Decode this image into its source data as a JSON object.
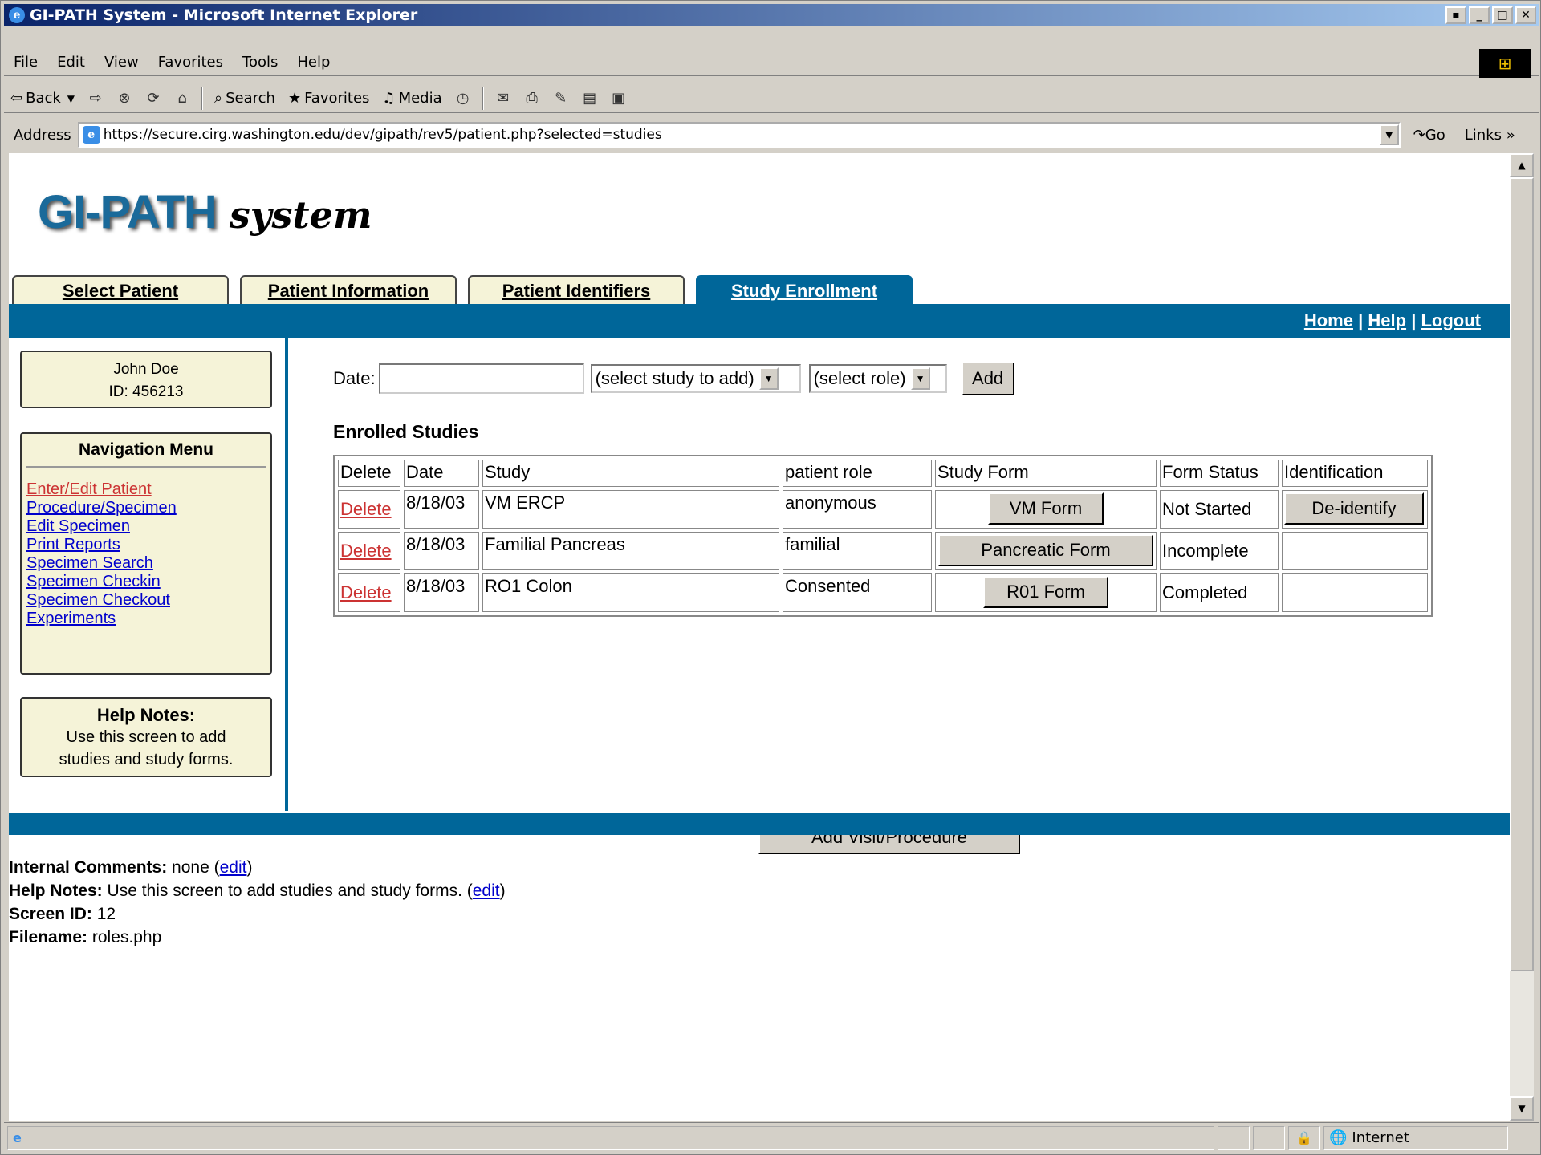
{
  "window": {
    "title": "GI-PATH System - Microsoft Internet Explorer"
  },
  "menu": [
    "File",
    "Edit",
    "View",
    "Favorites",
    "Tools",
    "Help"
  ],
  "toolbar": {
    "back": "Back",
    "search": "Search",
    "favorites": "Favorites",
    "media": "Media"
  },
  "address": {
    "label": "Address",
    "url": "https://secure.cirg.washington.edu/dev/gipath/rev5/patient.php?selected=studies",
    "go": "Go",
    "links": "Links"
  },
  "logo": {
    "main": "GI-PATH",
    "sub": "system"
  },
  "tabs": [
    "Select Patient",
    "Patient Information",
    "Patient Identifiers",
    "Study Enrollment"
  ],
  "active_tab": "Study Enrollment",
  "toplinks": {
    "home": "Home",
    "help": "Help",
    "logout": "Logout",
    "sep": "|"
  },
  "patient": {
    "name": "John Doe",
    "id": "ID: 456213"
  },
  "nav": {
    "title": "Navigation Menu",
    "items": [
      "Enter/Edit Patient",
      "Procedure/Specimen",
      "Edit Specimen",
      "Print Reports",
      "Specimen Search",
      "Specimen Checkin",
      "Specimen Checkout",
      "Experiments"
    ]
  },
  "help_box": {
    "title": "Help Notes:",
    "line1": "Use this screen to add",
    "line2": "studies and study forms."
  },
  "form": {
    "date_label": "Date:",
    "date_value": "",
    "study_select": "(select study to add)",
    "role_select": "(select role)",
    "add_button": "Add"
  },
  "enrolled": {
    "heading": "Enrolled Studies",
    "columns": [
      "Delete",
      "Date",
      "Study",
      "patient role",
      "Study Form",
      "Form Status",
      "Identification"
    ],
    "rows": [
      {
        "delete": "Delete",
        "date": "8/18/03",
        "study": "VM ERCP",
        "role": "anonymous",
        "form_button": "VM Form",
        "status": "Not Started",
        "ident_button": "De-identify"
      },
      {
        "delete": "Delete",
        "date": "8/18/03",
        "study": "Familial Pancreas",
        "role": "familial",
        "form_button": "Pancreatic Form",
        "status": "Incomplete",
        "ident_button": ""
      },
      {
        "delete": "Delete",
        "date": "8/18/03",
        "study": "RO1 Colon",
        "role": "Consented",
        "form_button": "R01 Form",
        "status": "Completed",
        "ident_button": ""
      }
    ]
  },
  "add_visit_button": "Add Visit/Procedure",
  "footer": {
    "internal_label": "Internal Comments:",
    "internal_value": "none (",
    "internal_edit": "edit",
    "close": ")",
    "help_label": "Help Notes:",
    "help_value": "Use this screen to add studies and study forms. (",
    "help_edit": "edit",
    "screen_label": "Screen ID:",
    "screen_value": "12",
    "file_label": "Filename:",
    "file_value": "roles.php"
  },
  "status": {
    "zone": "Internet"
  },
  "colors": {
    "brand_blue": "#006699",
    "panel_bg": "#f5f3d8",
    "link_visited": "#cc3333",
    "link": "#0000cc"
  }
}
